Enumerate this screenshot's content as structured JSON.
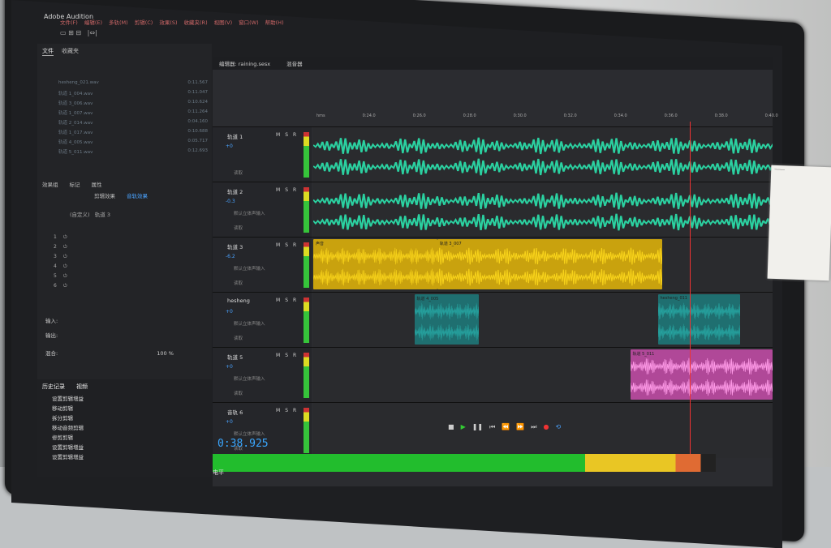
{
  "app": {
    "title": "Adobe Audition",
    "menu": [
      "文件(F)",
      "编辑(E)",
      "多轨(M)",
      "剪辑(C)",
      "效果(S)",
      "收藏夹(R)",
      "视图(V)",
      "窗口(W)",
      "帮助(H)"
    ]
  },
  "left_panel": {
    "tabs": [
      "文件",
      "收藏夹"
    ],
    "files": [
      {
        "name": "hesheng_021.wav",
        "duration": "0:11.567"
      },
      {
        "name": "轨道 1_004.wav",
        "duration": "0:11.047"
      },
      {
        "name": "轨道 3_006.wav",
        "duration": "0:10.624"
      },
      {
        "name": "轨道 1_007.wav",
        "duration": "0:11.264"
      },
      {
        "name": "轨道 2_014.wav",
        "duration": "0:04.160"
      },
      {
        "name": "轨道 1_017.wav",
        "duration": "0:10.688"
      },
      {
        "name": "轨道 4_005.wav",
        "duration": "0:05.717"
      },
      {
        "name": "轨道 5_011.wav",
        "duration": "0:12.693"
      }
    ],
    "fx_tabs": [
      "效果组",
      "标记",
      "属性"
    ],
    "fx_subtabs": [
      "剪辑效果",
      "音轨效果"
    ],
    "preset": "(自定义)",
    "track_label": "轨道 3",
    "fx_slots": [
      "1",
      "2",
      "3",
      "4",
      "5",
      "6"
    ],
    "input_label": "输入:",
    "output_label": "输出:",
    "mix_label": "混合:",
    "mix_value": "100 %",
    "history_tabs": [
      "历史记录",
      "视频"
    ],
    "history_items": [
      "设置剪辑增益",
      "移动剪辑",
      "拆分剪辑",
      "移动音频剪辑",
      "修剪剪辑",
      "设置剪辑增益",
      "设置剪辑增益"
    ]
  },
  "editor": {
    "tabs": [
      "编辑器: raining.sesx",
      "混音器"
    ],
    "ruler": [
      "hms",
      "0:24.0",
      "0:26.0",
      "0:28.0",
      "0:30.0",
      "0:32.0",
      "0:34.0",
      "0:36.0",
      "0:38.0",
      "0:40.0"
    ],
    "tracks": [
      {
        "name": "轨道 1",
        "vol": "+0",
        "pan": "0",
        "color": "#2bd0a0",
        "clips": [
          {
            "label": "",
            "start": 0.0,
            "end": 1.0
          }
        ]
      },
      {
        "name": "轨道 2",
        "vol": "-0.3",
        "pan": "0",
        "input": "默认立体声输入",
        "color": "#2bd0a0",
        "clips": [
          {
            "label": "",
            "start": 0.0,
            "end": 1.0
          }
        ]
      },
      {
        "name": "轨道 3",
        "vol": "-6.2",
        "pan": "0",
        "input": "默认立体声输入",
        "color": "#d4b21a",
        "clips": [
          {
            "label": "声音",
            "start": 0.0,
            "end": 0.27
          },
          {
            "label": "轨道 3_007",
            "start": 0.27,
            "end": 0.76
          }
        ]
      },
      {
        "name": "hesheng",
        "vol": "+0",
        "pan": "0",
        "input": "默认立体声输入",
        "color": "#27a8a4",
        "clips": [
          {
            "label": "轨道 4_005",
            "start": 0.22,
            "end": 0.36
          },
          {
            "label": "hesheng_011",
            "start": 0.75,
            "end": 0.93
          }
        ]
      },
      {
        "name": "轨道 5",
        "vol": "+0",
        "pan": "0",
        "input": "默认立体声输入",
        "color": "#d86cc4",
        "clips": [
          {
            "label": "轨道 5_011",
            "start": 0.69,
            "end": 1.0
          }
        ]
      },
      {
        "name": "音轨 6",
        "vol": "+0",
        "pan": "0",
        "input": "默认立体声输入",
        "color": "#2bd0a0",
        "clips": []
      }
    ],
    "read_label": "读取",
    "time": "0:38.925",
    "level_label": "电平"
  }
}
